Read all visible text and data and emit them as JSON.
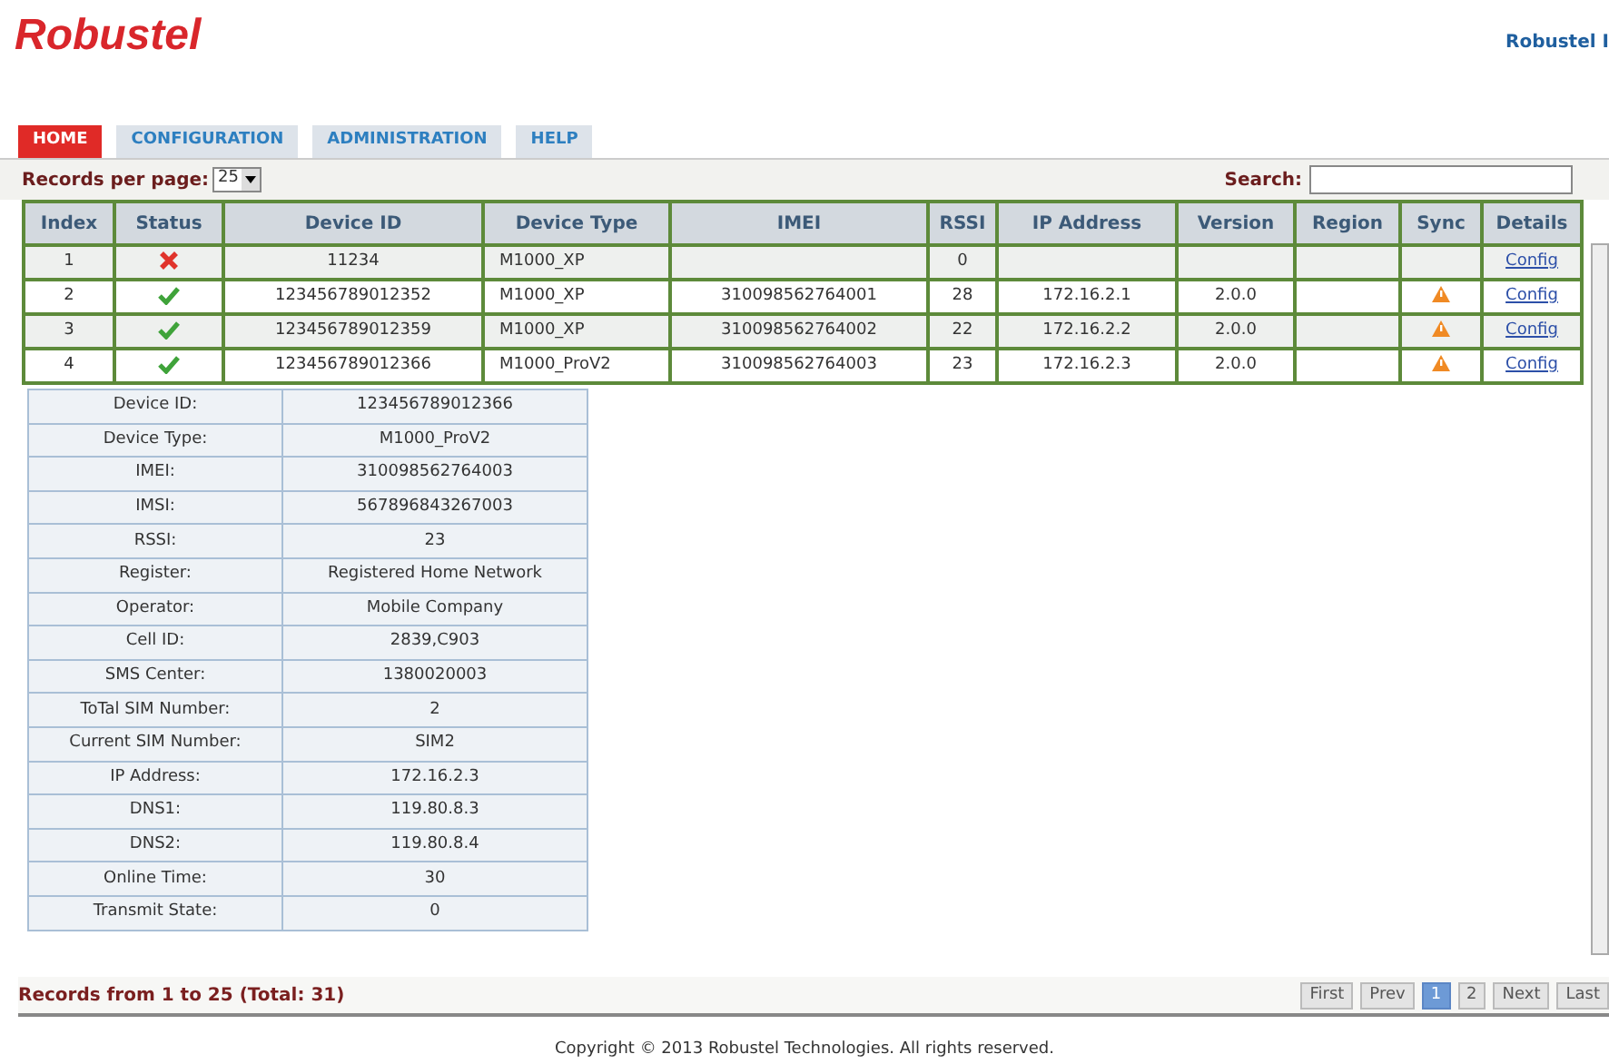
{
  "header": {
    "logo": "Robustel",
    "user_link": "Robustel I"
  },
  "tabs": [
    {
      "label": "HOME",
      "selected": true
    },
    {
      "label": "CONFIGURATION",
      "selected": false
    },
    {
      "label": "ADMINISTRATION",
      "selected": false
    },
    {
      "label": "HELP",
      "selected": false
    }
  ],
  "toolbar": {
    "records_label": "Records per page:",
    "records_value": "25",
    "search_label": "Search:"
  },
  "table": {
    "columns": [
      "Index",
      "Status",
      "Device ID",
      "Device Type",
      "IMEI",
      "RSSI",
      "IP Address",
      "Version",
      "Region",
      "Sync",
      "Details"
    ],
    "rows": [
      {
        "index": "1",
        "online": false,
        "device_id": "11234",
        "device_type": "M1000_XP",
        "imei": "",
        "rssi": "0",
        "ip": "",
        "version": "",
        "region": "",
        "sync_warning": false,
        "details": "Config"
      },
      {
        "index": "2",
        "online": true,
        "device_id": "123456789012352",
        "device_type": "M1000_XP",
        "imei": "310098562764001",
        "rssi": "28",
        "ip": "172.16.2.1",
        "version": "2.0.0",
        "region": "",
        "sync_warning": true,
        "details": "Config"
      },
      {
        "index": "3",
        "online": true,
        "device_id": "123456789012359",
        "device_type": "M1000_XP",
        "imei": "310098562764002",
        "rssi": "22",
        "ip": "172.16.2.2",
        "version": "2.0.0",
        "region": "",
        "sync_warning": true,
        "details": "Config"
      },
      {
        "index": "4",
        "online": true,
        "device_id": "123456789012366",
        "device_type": "M1000_ProV2",
        "imei": "310098562764003",
        "rssi": "23",
        "ip": "172.16.2.3",
        "version": "2.0.0",
        "region": "",
        "sync_warning": true,
        "details": "Config"
      }
    ]
  },
  "details": [
    {
      "label": "Device ID:",
      "value": "123456789012366"
    },
    {
      "label": "Device Type:",
      "value": "M1000_ProV2"
    },
    {
      "label": "IMEI:",
      "value": "310098562764003"
    },
    {
      "label": "IMSI:",
      "value": "567896843267003"
    },
    {
      "label": "RSSI:",
      "value": "23"
    },
    {
      "label": "Register:",
      "value": "Registered Home Network"
    },
    {
      "label": "Operator:",
      "value": "Mobile Company"
    },
    {
      "label": "Cell ID:",
      "value": "2839,C903"
    },
    {
      "label": "SMS Center:",
      "value": "1380020003"
    },
    {
      "label": "ToTal SIM Number:",
      "value": "2"
    },
    {
      "label": "Current SIM Number:",
      "value": "SIM2"
    },
    {
      "label": "IP Address:",
      "value": "172.16.2.3"
    },
    {
      "label": "DNS1:",
      "value": "119.80.8.3"
    },
    {
      "label": "DNS2:",
      "value": "119.80.8.4"
    },
    {
      "label": "Online Time:",
      "value": "30"
    },
    {
      "label": "Transmit State:",
      "value": "0"
    }
  ],
  "footer": {
    "records": "Records from 1 to 25 (Total: 31)",
    "pages": [
      {
        "label": "First",
        "selected": false
      },
      {
        "label": "Prev",
        "selected": false
      },
      {
        "label": "1",
        "selected": true
      },
      {
        "label": "2",
        "selected": false
      },
      {
        "label": "Next",
        "selected": false
      },
      {
        "label": "Last",
        "selected": false
      }
    ]
  },
  "copyright": "Copyright © 2013 Robustel Technologies. All rights reserved."
}
